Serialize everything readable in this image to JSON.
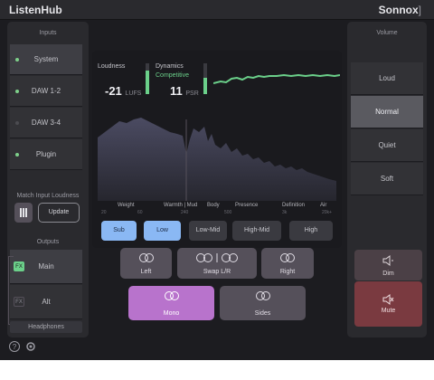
{
  "app": {
    "title": "ListenHub",
    "brand": "Sonnox",
    "brand_mark": "]"
  },
  "inputs": {
    "label": "Inputs",
    "items": [
      {
        "label": "System",
        "active": true,
        "dot": "green"
      },
      {
        "label": "DAW 1-2",
        "active": false,
        "dot": "green"
      },
      {
        "label": "DAW 3-4",
        "active": false,
        "dot": "grey"
      },
      {
        "label": "Plugin",
        "active": false,
        "dot": "green"
      }
    ]
  },
  "match_loudness": {
    "label": "Match Input Loudness",
    "meter_icon": "bars-icon",
    "update_label": "Update"
  },
  "outputs": {
    "label": "Outputs",
    "items": [
      {
        "label": "Main",
        "badge": "FX",
        "active": true
      },
      {
        "label": "Alt",
        "badge": "FX",
        "active": false
      }
    ],
    "headphones_label": "Headphones"
  },
  "meters": {
    "loudness": {
      "label": "Loudness",
      "value": "-21",
      "unit": "LUFS"
    },
    "dynamics": {
      "label": "Dynamics",
      "status": "Competitive",
      "value": "11",
      "unit": "PSR"
    }
  },
  "spectrum": {
    "top_labels": [
      "Weight",
      "Warmth | Mud",
      "Body",
      "Presence",
      "Definition",
      "Air"
    ],
    "freq_labels": [
      "20",
      "60",
      "240",
      "500",
      "3k",
      "20k+"
    ]
  },
  "filters": [
    {
      "label": "Sub",
      "on": true
    },
    {
      "label": "Low",
      "on": true
    },
    {
      "label": "Low-Mid",
      "on": false
    },
    {
      "label": "High-Mid",
      "on": false
    },
    {
      "label": "High",
      "on": false
    }
  ],
  "monitor": {
    "left": "Left",
    "swap": "Swap L/R",
    "right": "Right",
    "mono": "Mono",
    "sides": "Sides"
  },
  "volume": {
    "label": "Volume",
    "items": [
      {
        "label": "Loud",
        "active": false
      },
      {
        "label": "Normal",
        "active": true
      },
      {
        "label": "Quiet",
        "active": false
      },
      {
        "label": "Soft",
        "active": false
      }
    ],
    "dim": "Dim",
    "mute": "Mute"
  },
  "colors": {
    "accent_blue": "#8ab8f4",
    "accent_purple": "#b873cc",
    "mute_red": "#7a3a40",
    "meter_green": "#6bd08a"
  }
}
